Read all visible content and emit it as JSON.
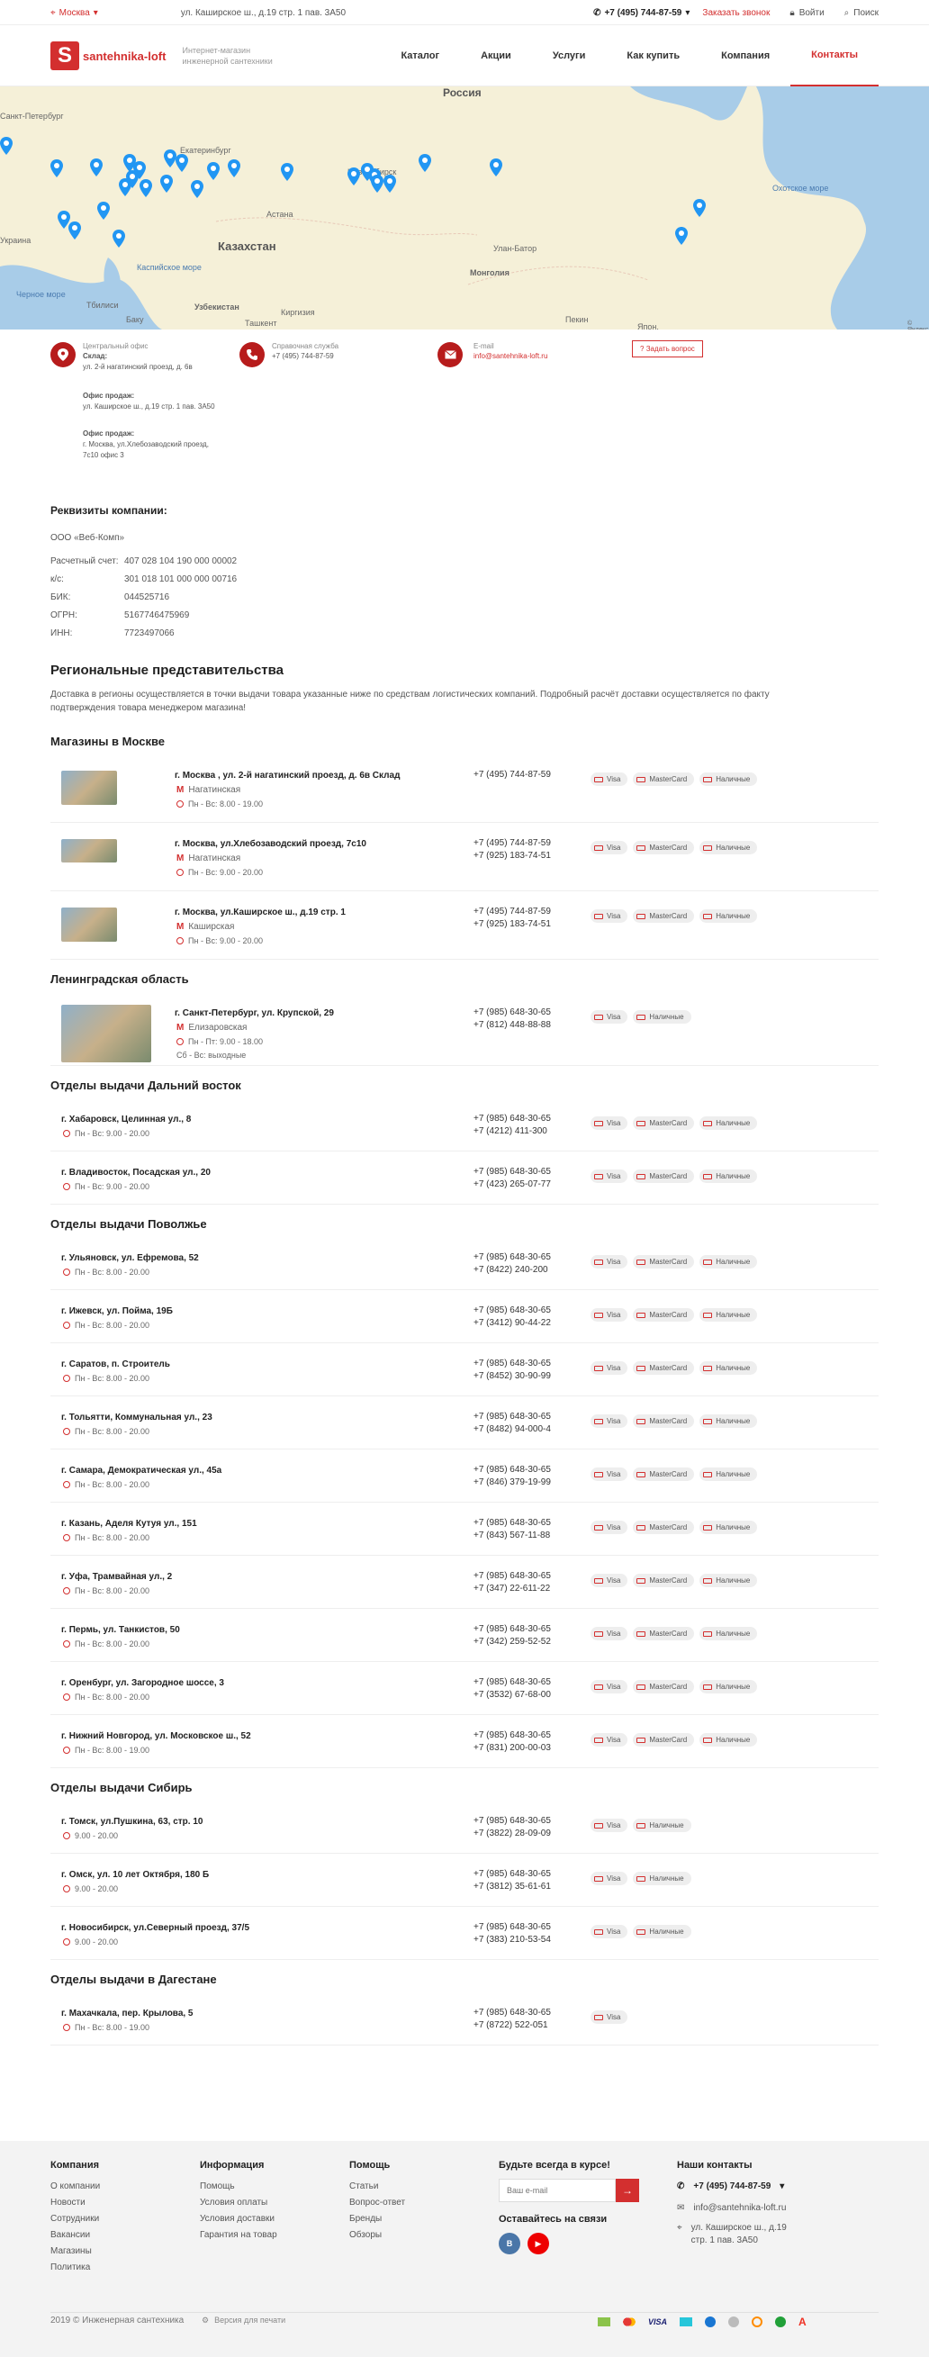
{
  "topbar": {
    "city": "Москва",
    "address": "ул. Каширское ш., д.19 стр. 1 пав. 3А50",
    "phone": "+7 (495) 744-87-59",
    "callback": "Заказать звонок",
    "login": "Войти",
    "search": "Поиск"
  },
  "header": {
    "logo_letter": "S",
    "logo_text": "santehnika-loft",
    "tagline": "Интернет-магазин инженерной сантехники",
    "nav": [
      "Каталог",
      "Акции",
      "Услуги",
      "Как купить",
      "Компания",
      "Контакты"
    ]
  },
  "map": {
    "labels": [
      "Россия",
      "Казахстан",
      "Монголия",
      "Охотское море",
      "Санкт-Петербург",
      "Екатеринбург",
      "Новосибирск",
      "Астана",
      "Улан-Батор",
      "Узбекистан",
      "Киргизия",
      "Тбилиси",
      "Баку",
      "Ташкент",
      "Каспийское море",
      "Черное море",
      "Украина",
      "Пекин",
      "Япон.",
      "© Яндекс"
    ]
  },
  "contacts": {
    "office_label": "Центральный офис",
    "warehouse_label": "Склад:",
    "warehouse": "ул. 2-й нагатинский проезд, д. 6в",
    "sales1_label": "Офис продаж:",
    "sales1": "ул. Каширское ш., д.19 стр. 1 пав. 3А50",
    "sales2_label": "Офис продаж:",
    "sales2": "г. Москва, ул.Хлебозаводский проезд, 7с10 офис 3",
    "help_label": "Справочная служба",
    "help_phone": "+7 (495) 744-87-59",
    "email_label": "E-mail",
    "email": "info@santehnika-loft.ru",
    "ask": "Задать вопрос"
  },
  "requisites": {
    "title": "Реквизиты компании:",
    "company": "ООО «Веб-Комп»",
    "rows": [
      [
        "Расчетный счет:",
        "407 028 104 190 000 00002"
      ],
      [
        "к/с:",
        "301 018 101 000 000 00716"
      ],
      [
        "БИК:",
        "044525716"
      ],
      [
        "ОГРН:",
        "5167746475969"
      ],
      [
        "ИНН:",
        "7723497066"
      ]
    ]
  },
  "regional": {
    "title": "Региональные представительства",
    "text": "Доставка в регионы осуществляется в точки выдачи товара указанные ниже по средствам логистических компаний. Подробный расчёт доставки осуществляется по факту подтверждения товара менеджером магазина!"
  },
  "sections": [
    {
      "title": "Магазины в Москве",
      "stores": [
        {
          "name": "г. Москва , ул. 2-й нагатинский проезд, д. 6в Склад",
          "metro": "Нагатинская",
          "hours": "Пн - Вс: 8.00 - 19.00",
          "phones": [
            "+7 (495) 744-87-59"
          ],
          "pay": [
            "Visa",
            "MasterCard",
            "Наличные"
          ]
        },
        {
          "name": "г. Москва, ул.Хлебозаводский проезд, 7с10",
          "metro": "Нагатинская",
          "hours": "Пн - Вс: 9.00 - 20.00",
          "phones": [
            "+7 (495) 744-87-59",
            "+7 (925) 183-74-51"
          ],
          "pay": [
            "Visa",
            "MasterCard",
            "Наличные"
          ]
        },
        {
          "name": "г. Москва, ул.Каширское ш., д.19 стр. 1",
          "metro": "Каширская",
          "hours": "Пн - Вс: 9.00 - 20.00",
          "phones": [
            "+7 (495) 744-87-59",
            "+7 (925) 183-74-51"
          ],
          "pay": [
            "Visa",
            "MasterCard",
            "Наличные"
          ]
        }
      ]
    },
    {
      "title": "Ленинградская область",
      "stores": [
        {
          "name": "г. Санкт-Петербург, ул. Крупской, 29",
          "metro": "Елизаровская",
          "hours": "Пн - Пт: 9.00 - 18.00",
          "hours2": "Сб - Вс: выходные",
          "phones": [
            "+7 (985) 648-30-65",
            "+7 (812) 448-88-88"
          ],
          "pay": [
            "Visa",
            "Наличные"
          ]
        }
      ]
    },
    {
      "title": "Отделы выдачи Дальний восток",
      "stores": [
        {
          "name": "г. Хабаровск, Целинная ул., 8",
          "hours": "Пн - Вс: 9.00 - 20.00",
          "phones": [
            "+7 (985) 648-30-65",
            "+7 (4212) 411-300"
          ],
          "pay": [
            "Visa",
            "MasterCard",
            "Наличные"
          ]
        },
        {
          "name": "г. Владивосток, Посадская ул., 20",
          "hours": "Пн - Вс: 9.00 - 20.00",
          "phones": [
            "+7 (985) 648-30-65",
            "+7 (423) 265-07-77"
          ],
          "pay": [
            "Visa",
            "MasterCard",
            "Наличные"
          ]
        }
      ]
    },
    {
      "title": "Отделы выдачи Поволжье",
      "stores": [
        {
          "name": "г. Ульяновск, ул. Ефремова, 52",
          "hours": "Пн - Вс: 8.00 - 20.00",
          "phones": [
            "+7 (985) 648-30-65",
            "+7 (8422) 240-200"
          ],
          "pay": [
            "Visa",
            "MasterCard",
            "Наличные"
          ]
        },
        {
          "name": "г. Ижевск, ул. Пойма, 19Б",
          "hours": "Пн - Вс: 8.00 - 20.00",
          "phones": [
            "+7 (985) 648-30-65",
            "+7 (3412) 90-44-22"
          ],
          "pay": [
            "Visa",
            "MasterCard",
            "Наличные"
          ]
        },
        {
          "name": "г. Саратов, п. Строитель",
          "hours": "Пн - Вс: 8.00 - 20.00",
          "phones": [
            "+7 (985) 648-30-65",
            "+7 (8452) 30-90-99"
          ],
          "pay": [
            "Visa",
            "MasterCard",
            "Наличные"
          ]
        },
        {
          "name": "г. Тольятти, Коммунальная ул., 23",
          "hours": "Пн - Вс: 8.00 - 20.00",
          "phones": [
            "+7 (985) 648-30-65",
            "+7 (8482) 94-000-4"
          ],
          "pay": [
            "Visa",
            "MasterCard",
            "Наличные"
          ]
        },
        {
          "name": "г. Самара, Демократическая ул., 45а",
          "hours": "Пн - Вс: 8.00 - 20.00",
          "phones": [
            "+7 (985) 648-30-65",
            "+7 (846) 379-19-99"
          ],
          "pay": [
            "Visa",
            "MasterCard",
            "Наличные"
          ]
        },
        {
          "name": "г. Казань, Аделя Кутуя ул., 151",
          "hours": "Пн - Вс: 8.00 - 20.00",
          "phones": [
            "+7 (985) 648-30-65",
            "+7 (843) 567-11-88"
          ],
          "pay": [
            "Visa",
            "MasterCard",
            "Наличные"
          ]
        },
        {
          "name": "г. Уфа, Трамвайная ул., 2",
          "hours": "Пн - Вс: 8.00 - 20.00",
          "phones": [
            "+7 (985) 648-30-65",
            "+7 (347) 22-611-22"
          ],
          "pay": [
            "Visa",
            "MasterCard",
            "Наличные"
          ]
        },
        {
          "name": "г. Пермь, ул. Танкистов, 50",
          "hours": "Пн - Вс: 8.00 - 20.00",
          "phones": [
            "+7 (985) 648-30-65",
            "+7 (342) 259-52-52"
          ],
          "pay": [
            "Visa",
            "MasterCard",
            "Наличные"
          ]
        },
        {
          "name": "г. Оренбург, ул. Загородное шоссе, 3",
          "hours": "Пн - Вс: 8.00 - 20.00",
          "phones": [
            "+7 (985) 648-30-65",
            "+7 (3532) 67-68-00"
          ],
          "pay": [
            "Visa",
            "MasterCard",
            "Наличные"
          ]
        },
        {
          "name": "г. Нижний Новгород, ул. Московское ш., 52",
          "hours": "Пн - Вс: 8.00 - 19.00",
          "phones": [
            "+7 (985) 648-30-65",
            "+7 (831) 200-00-03"
          ],
          "pay": [
            "Visa",
            "MasterCard",
            "Наличные"
          ]
        }
      ]
    },
    {
      "title": "Отделы выдачи Сибирь",
      "stores": [
        {
          "name": "г. Томск, ул.Пушкина, 63, стр. 10",
          "hours": "9.00 - 20.00",
          "phones": [
            "+7 (985) 648-30-65",
            "+7 (3822) 28-09-09"
          ],
          "pay": [
            "Visa",
            "Наличные"
          ]
        },
        {
          "name": "г. Омск, ул. 10 лет Октября, 180 Б",
          "hours": "9.00 - 20.00",
          "phones": [
            "+7 (985) 648-30-65",
            "+7 (3812) 35-61-61"
          ],
          "pay": [
            "Visa",
            "Наличные"
          ]
        },
        {
          "name": "г. Новосибирск, ул.Северный проезд, 37/5",
          "hours": "9.00 - 20.00",
          "phones": [
            "+7 (985) 648-30-65",
            "+7 (383) 210-53-54"
          ],
          "pay": [
            "Visa",
            "Наличные"
          ]
        }
      ]
    },
    {
      "title": "Отделы выдачи в Дагестане",
      "stores": [
        {
          "name": "г. Махачкала, пер. Крылова, 5",
          "hours": "Пн - Вс: 8.00 - 19.00",
          "phones": [
            "+7 (985) 648-30-65",
            "+7 (8722) 522-051"
          ],
          "pay": [
            "Visa"
          ]
        }
      ]
    }
  ],
  "footer": {
    "cols": [
      {
        "title": "Компания",
        "items": [
          "О компании",
          "Новости",
          "Сотрудники",
          "Вакансии",
          "Магазины",
          "Политика"
        ]
      },
      {
        "title": "Информация",
        "items": [
          "Помощь",
          "Условия оплаты",
          "Условия доставки",
          "Гарантия на товар"
        ]
      },
      {
        "title": "Помощь",
        "items": [
          "Статьи",
          "Вопрос-ответ",
          "Бренды",
          "Обзоры"
        ]
      }
    ],
    "subscribe_title": "Будьте всегда в курсе!",
    "email_placeholder": "Ваш e-mail",
    "social_title": "Оставайтесь на связи",
    "social": [
      "В",
      "▶"
    ],
    "contacts_title": "Наши контакты",
    "phone": "+7 (495) 744-87-59",
    "email": "info@santehnika-loft.ru",
    "address": "ул. Каширское ш., д.19 стр. 1 пав. 3А50",
    "copyright": "2019 © Инженерная сантехника",
    "print": "Версия для печати",
    "payment_icons": [
      "VISA"
    ]
  },
  "colors": {
    "accent": "#d32f2f",
    "map_land": "#f5f0d8",
    "map_water": "#a8cce8",
    "footer_bg": "#f3f3f3"
  }
}
